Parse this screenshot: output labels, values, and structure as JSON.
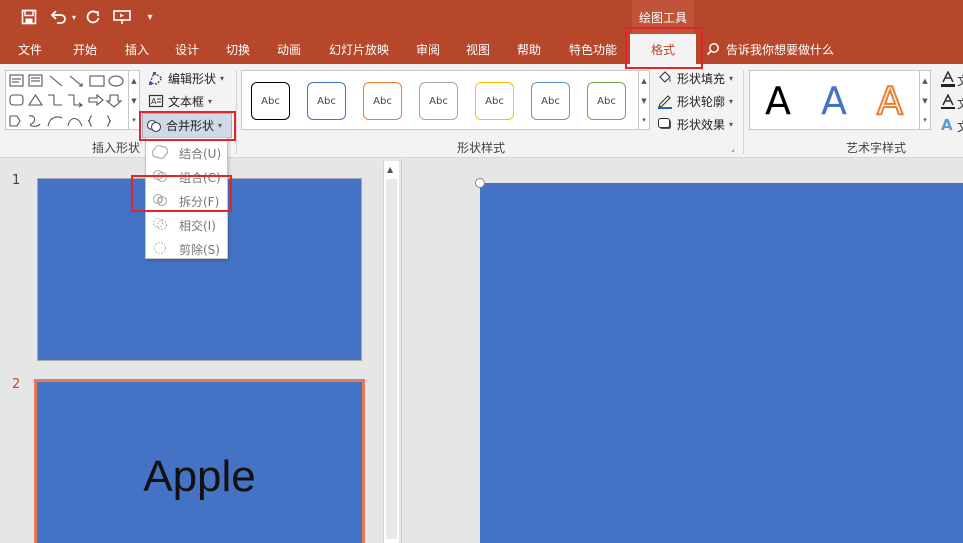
{
  "titlebar": {
    "context_label": "绘图工具",
    "quick_access": [
      "save-icon",
      "undo-icon",
      "redo-icon",
      "present-icon",
      "customize-icon"
    ]
  },
  "tabs": [
    {
      "label": "文件"
    },
    {
      "label": "开始"
    },
    {
      "label": "插入"
    },
    {
      "label": "设计"
    },
    {
      "label": "切换"
    },
    {
      "label": "动画"
    },
    {
      "label": "幻灯片放映"
    },
    {
      "label": "审阅"
    },
    {
      "label": "视图"
    },
    {
      "label": "帮助"
    },
    {
      "label": "特色功能"
    },
    {
      "label": "格式",
      "active": true
    }
  ],
  "tell_me": "告诉我你想要做什么",
  "ribbon": {
    "insert_shapes": {
      "label": "插入形状",
      "edit_shape": "编辑形状",
      "text_box": "文本框",
      "merge_shapes": "合并形状"
    },
    "shape_styles": {
      "label": "形状样式",
      "swatch_text": "Abc",
      "swatch_colors": [
        "#000000",
        "#4472c4",
        "#ed7d31",
        "#a5a5a5",
        "#ffc000",
        "#5b9bd5",
        "#70ad47"
      ],
      "fill": "形状填充",
      "outline": "形状轮廓",
      "effects": "形状效果"
    },
    "wordart": {
      "label": "艺术字样式",
      "sample": "A",
      "side_glyph": "文"
    }
  },
  "merge_menu": [
    {
      "label": "结合(U)",
      "icon": "union-icon"
    },
    {
      "label": "组合(C)",
      "icon": "combine-icon"
    },
    {
      "label": "拆分(F)",
      "icon": "fragment-icon"
    },
    {
      "label": "相交(I)",
      "icon": "intersect-icon"
    },
    {
      "label": "剪除(S)",
      "icon": "subtract-icon"
    }
  ],
  "slides": [
    {
      "number": "1",
      "text": ""
    },
    {
      "number": "2",
      "text": "Apple",
      "selected": true
    }
  ],
  "colors": {
    "ribbon_brand": "#b7472a",
    "slide_fill": "#4472c4",
    "highlight": "#e0262a"
  }
}
